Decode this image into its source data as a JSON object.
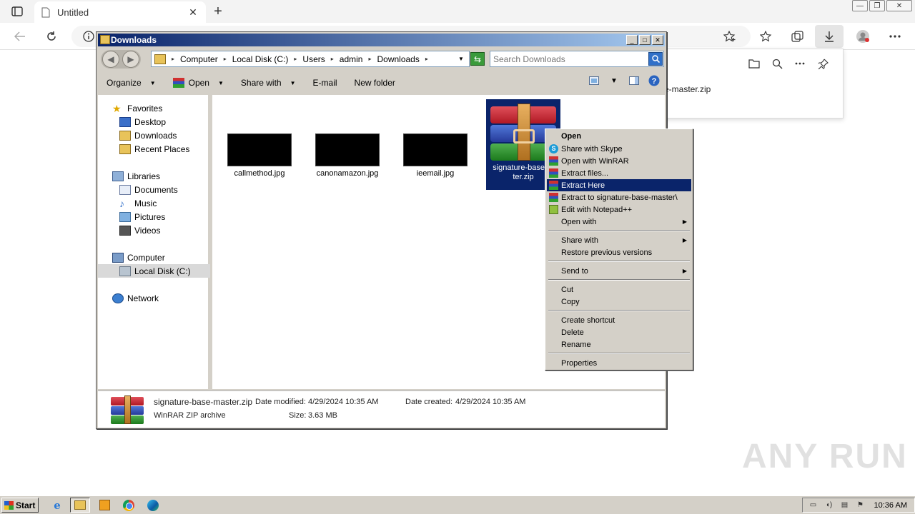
{
  "browser": {
    "tab_title": "Untitled",
    "tab_close": "✕",
    "new_tab": "+",
    "window_controls": [
      "—",
      "❐",
      "✕"
    ],
    "download_item": "e-master.zip",
    "icons": [
      "tab-actions-icon",
      "back-icon",
      "refresh-icon",
      "info-icon",
      "add-favorite-icon",
      "favorites-icon",
      "collections-icon",
      "downloads-icon",
      "profile-icon",
      "more-icon",
      "open-folder-icon",
      "search-icon",
      "pin-icon"
    ]
  },
  "explorer": {
    "title": "Downloads",
    "title_buttons": [
      "_",
      "□",
      "✕"
    ],
    "breadcrumb": [
      "Computer",
      "Local Disk (C:)",
      "Users",
      "admin",
      "Downloads"
    ],
    "search_placeholder": "Search Downloads",
    "toolbar": {
      "organize": "Organize",
      "open": "Open",
      "share_with": "Share with",
      "email": "E-mail",
      "new_folder": "New folder"
    },
    "nav": {
      "favorites": "Favorites",
      "desktop": "Desktop",
      "downloads": "Downloads",
      "recent_places": "Recent Places",
      "libraries": "Libraries",
      "documents": "Documents",
      "music": "Music",
      "pictures": "Pictures",
      "videos": "Videos",
      "computer": "Computer",
      "local_disk": "Local Disk (C:)",
      "network": "Network"
    },
    "files": [
      {
        "name": "callmethod.jpg"
      },
      {
        "name": "canonamazon.jpg"
      },
      {
        "name": "ieemail.jpg"
      },
      {
        "name": "signature-base-master.zip",
        "label_line1": "signature-base-m",
        "label_line2": "ter.zip",
        "selected": true
      }
    ],
    "details": {
      "name": "signature-base-master.zip",
      "type": "WinRAR ZIP archive",
      "date_modified_label": "Date modified:",
      "date_modified": "4/29/2024 10:35 AM",
      "date_created_label": "Date created:",
      "date_created": "4/29/2024 10:35 AM",
      "size_label": "Size:",
      "size": "3.63 MB"
    }
  },
  "context_menu": {
    "items": [
      {
        "label": "Open",
        "bold": true
      },
      {
        "label": "Share with Skype",
        "icon": "skype-icon"
      },
      {
        "label": "Open with WinRAR",
        "icon": "winrar-icon"
      },
      {
        "label": "Extract files...",
        "icon": "winrar-icon"
      },
      {
        "label": "Extract Here",
        "icon": "winrar-icon",
        "highlighted": true
      },
      {
        "label": "Extract to signature-base-master\\",
        "icon": "winrar-icon"
      },
      {
        "label": "Edit with Notepad++",
        "icon": "notepadpp-icon"
      },
      {
        "label": "Open with",
        "submenu": true
      },
      {
        "label": "Share with",
        "submenu": true
      },
      {
        "label": "Restore previous versions"
      },
      {
        "label": "Send to",
        "submenu": true
      },
      {
        "label": "Cut"
      },
      {
        "label": "Copy"
      },
      {
        "label": "Create shortcut"
      },
      {
        "label": "Delete"
      },
      {
        "label": "Rename"
      },
      {
        "label": "Properties"
      }
    ]
  },
  "watermark": "ANY RUN",
  "taskbar": {
    "start_label": "Start",
    "apps": [
      "internet-explorer-icon",
      "file-explorer-icon",
      "media-player-icon",
      "chrome-icon",
      "edge-icon"
    ],
    "clock": "10:36 AM"
  },
  "colors": {
    "selection": "#0a246a",
    "titlebar_start": "#0a246a",
    "titlebar_end": "#a6caf0",
    "classic_face": "#d4d0c8"
  }
}
